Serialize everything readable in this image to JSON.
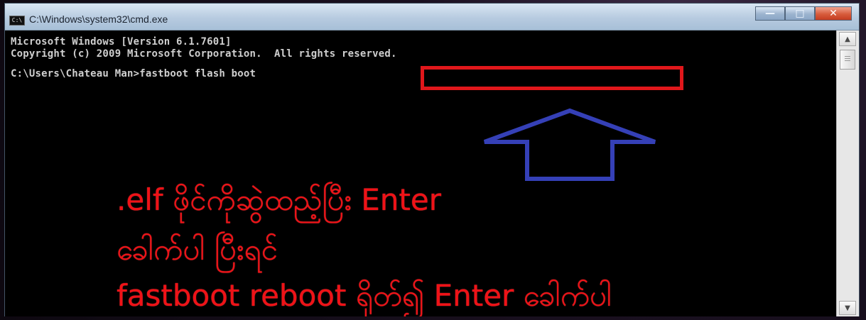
{
  "window": {
    "title": "C:\\Windows\\system32\\cmd.exe",
    "icon_label": "C:\\"
  },
  "console": {
    "line1": "Microsoft Windows [Version 6.1.7601]",
    "line2": "Copyright (c) 2009 Microsoft Corporation.  All rights reserved.",
    "line3": "C:\\Users\\Chateau Man>fastboot flash boot"
  },
  "annotation": {
    "text_1": ".elf ဖိုင်ကိုဆွဲထည့်ပြီး Enter",
    "text_2": "ခေါက်ပါ ပြီးရင်",
    "text_3": "fastboot reboot ရိုတ်၍ Enter ခေါက်ပါ",
    "red_box_color": "#e0171b",
    "arrow_color": "#3540b7",
    "text_color": "#ef1217"
  },
  "scrollbar": {
    "up_icon": "▲",
    "down_icon": "▼"
  },
  "controls": {
    "minimize": "—",
    "maximize": "□",
    "close": "✕"
  }
}
